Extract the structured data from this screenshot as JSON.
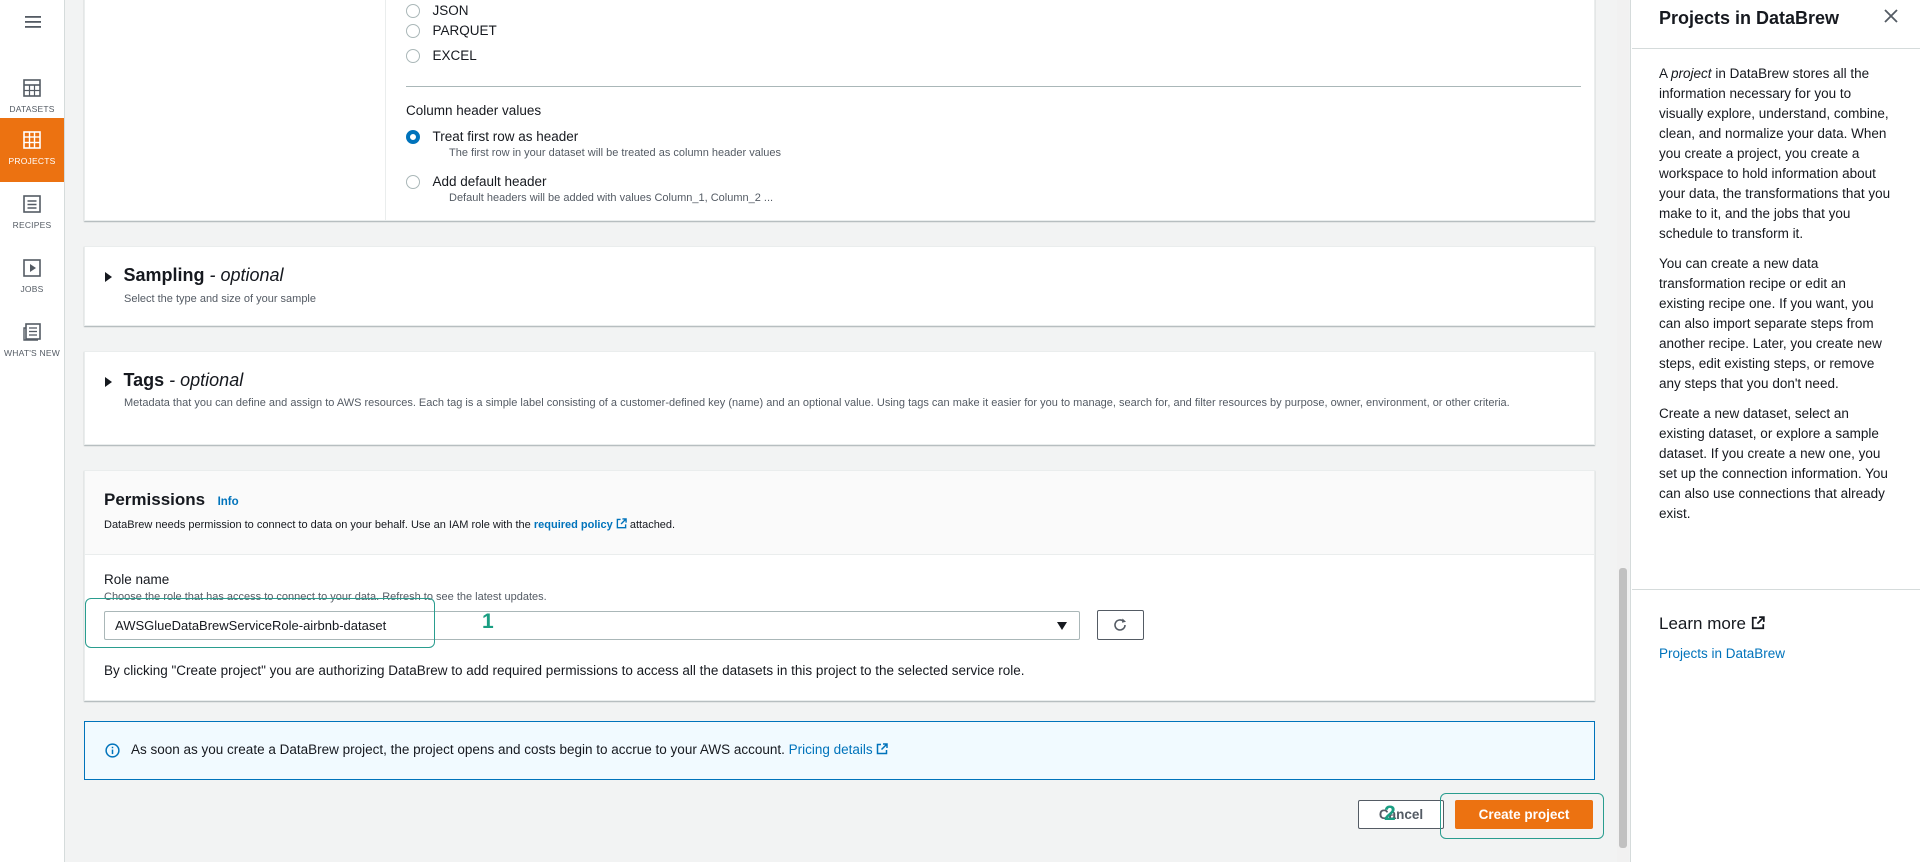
{
  "nav": {
    "menu_icon": "hamburger-icon",
    "items": [
      {
        "label": "DATASETS",
        "icon": "table-icon"
      },
      {
        "label": "PROJECTS",
        "icon": "grid-icon"
      },
      {
        "label": "RECIPES",
        "icon": "list-icon"
      },
      {
        "label": "JOBS",
        "icon": "play-icon"
      },
      {
        "label": "WHAT'S NEW",
        "icon": "newspaper-icon"
      }
    ],
    "active": "PROJECTS",
    "accent_color": "#ec7211"
  },
  "file_type": {
    "options": [
      "JSON",
      "PARQUET",
      "EXCEL"
    ]
  },
  "column_header": {
    "title": "Column header values",
    "options": [
      {
        "label": "Treat first row as header",
        "desc": "The first row in your dataset will be treated as column header values",
        "checked": true
      },
      {
        "label": "Add default header",
        "desc": "Default headers will be added with values Column_1, Column_2 ...",
        "checked": false
      }
    ]
  },
  "sampling": {
    "title": "Sampling",
    "optional": "- optional",
    "desc": "Select the type and size of your sample"
  },
  "tags": {
    "title": "Tags",
    "optional": "- optional",
    "desc": "Metadata that you can define and assign to AWS resources. Each tag is a simple label consisting of a customer-defined key (name) and an optional value. Using tags can make it easier for you to manage, search for, and filter resources by purpose, owner, environment, or other criteria."
  },
  "permissions": {
    "title": "Permissions",
    "info": "Info",
    "desc_prefix": "DataBrew needs permission to connect to data on your behalf. Use an IAM role with the",
    "desc_link": "required policy",
    "desc_suffix": "attached.",
    "role_label": "Role name",
    "role_help": "Choose the role that has access to connect to your data. Refresh to see the latest updates.",
    "role_value": "AWSGlueDataBrewServiceRole-airbnb-dataset",
    "consent": "By clicking \"Create project\" you are authorizing DataBrew to add required permissions to access all the datasets in this project to the selected service role."
  },
  "alert": {
    "text": "As soon as you create a DataBrew project, the project opens and costs begin to accrue to your AWS account.",
    "link": "Pricing details"
  },
  "actions": {
    "cancel": "Cancel",
    "create": "Create project"
  },
  "annotations": {
    "one": "1",
    "two": "2"
  },
  "help": {
    "title": "Projects in DataBrew",
    "p1_prefix": "A",
    "p1_em": "project",
    "p1_rest": "in DataBrew stores all the information necessary for you to visually explore, understand, combine, clean, and normalize your data. When you create a project, you create a workspace to hold information about your data, the transformations that you make to it, and the jobs that you schedule to transform it.",
    "p2": "You can create a new data transformation recipe or edit an existing recipe one. If you want, you can also import separate steps from another recipe. Later, you create new steps, edit existing steps, or remove any steps that you don't need.",
    "p3": "Create a new dataset, select an existing dataset, or explore a sample dataset. If you create a new one, you set up the connection information. You can also use connections that already exist.",
    "learn_more": "Learn more",
    "learn_link": "Projects in DataBrew"
  }
}
